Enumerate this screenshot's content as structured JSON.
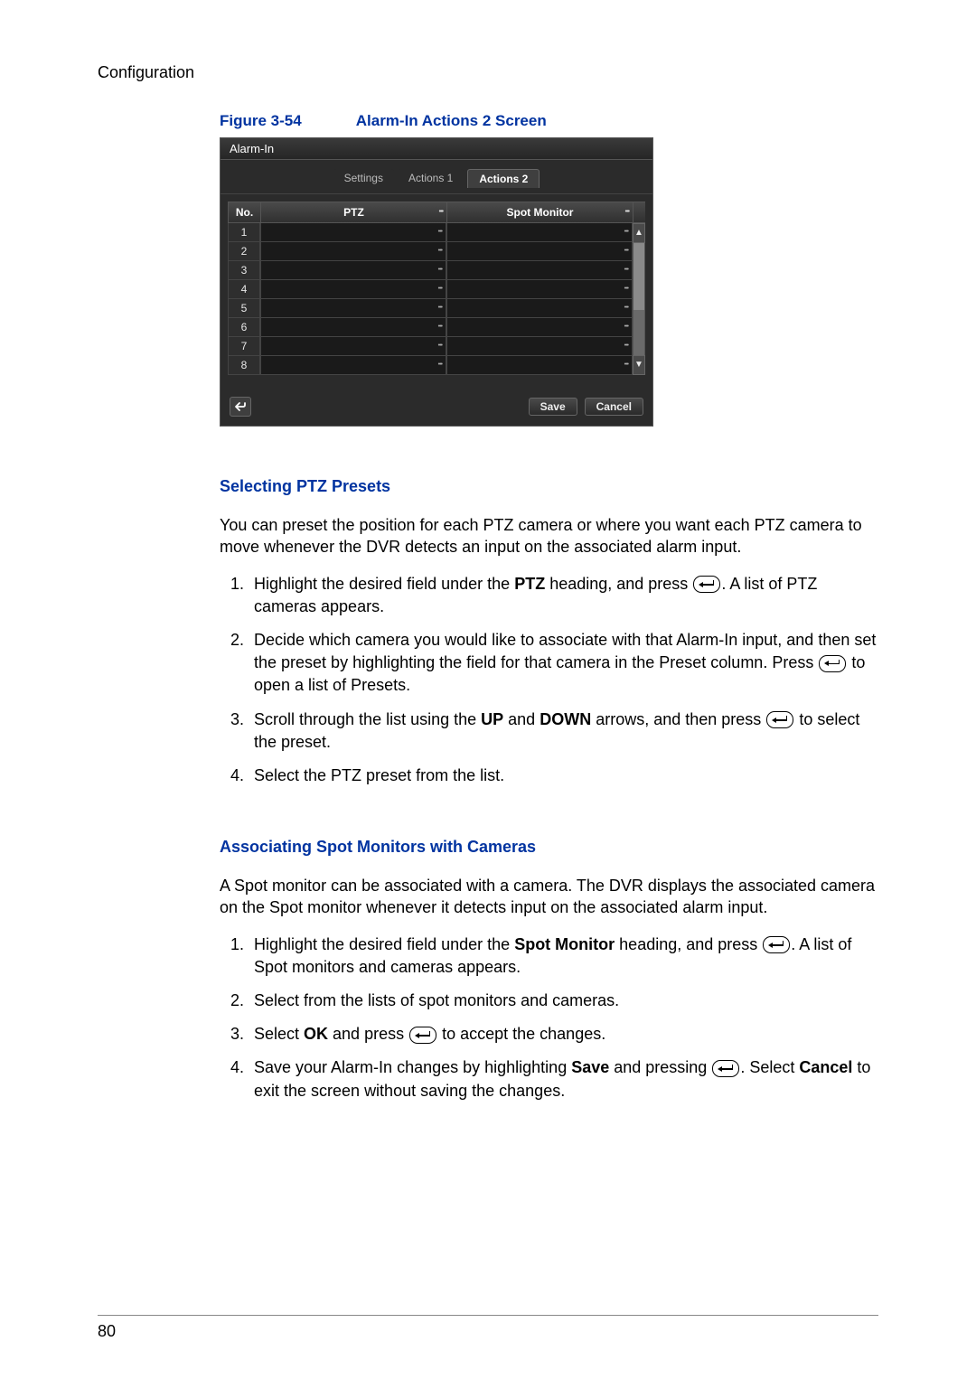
{
  "header": "Configuration",
  "figure": {
    "label": "Figure 3-54",
    "caption": "Alarm-In Actions 2 Screen"
  },
  "screenshot": {
    "title": "Alarm-In",
    "tabs": {
      "settings": "Settings",
      "actions1": "Actions 1",
      "actions2": "Actions 2"
    },
    "columns": {
      "no": "No.",
      "ptz": "PTZ",
      "spot": "Spot Monitor"
    },
    "rows": [
      "1",
      "2",
      "3",
      "4",
      "5",
      "6",
      "7",
      "8"
    ],
    "buttons": {
      "save": "Save",
      "cancel": "Cancel"
    }
  },
  "section1": {
    "title": "Selecting PTZ Presets",
    "intro": "You can preset the position for each PTZ camera or where you want each PTZ camera to move whenever the DVR detects an input on the associated alarm input.",
    "step1_a": "Highlight the desired field under the ",
    "step1_b": "PTZ",
    "step1_c": " heading, and press ",
    "step1_d": ". A list of PTZ cameras appears.",
    "step2_a": "Decide which camera you would like to associate with that Alarm-In input, and then set the preset by highlighting the field for that camera in the Preset column. Press ",
    "step2_b": " to open a list of Presets.",
    "step3_a": "Scroll through the list using the ",
    "step3_b": "UP",
    "step3_c": " and ",
    "step3_d": "DOWN",
    "step3_e": " arrows, and then press ",
    "step3_f": " to select the preset.",
    "step4": "Select the PTZ preset from the list."
  },
  "section2": {
    "title": "Associating Spot Monitors with Cameras",
    "intro": "A Spot monitor can be associated with a camera. The DVR displays the associated camera on the Spot monitor whenever it detects input on the associated alarm input.",
    "step1_a": "Highlight the desired field under the ",
    "step1_b": "Spot Monitor",
    "step1_c": " heading, and press ",
    "step1_d": ". A list of Spot monitors and cameras appears.",
    "step2": "Select from the lists of spot monitors and cameras.",
    "step3_a": "Select ",
    "step3_b": "OK",
    "step3_c": " and press ",
    "step3_d": " to accept the changes.",
    "step4_a": "Save your Alarm-In changes by highlighting ",
    "step4_b": "Save",
    "step4_c": " and pressing ",
    "step4_d": ". Select ",
    "step4_e": "Cancel",
    "step4_f": " to exit the screen without saving the changes."
  },
  "page_number": "80"
}
